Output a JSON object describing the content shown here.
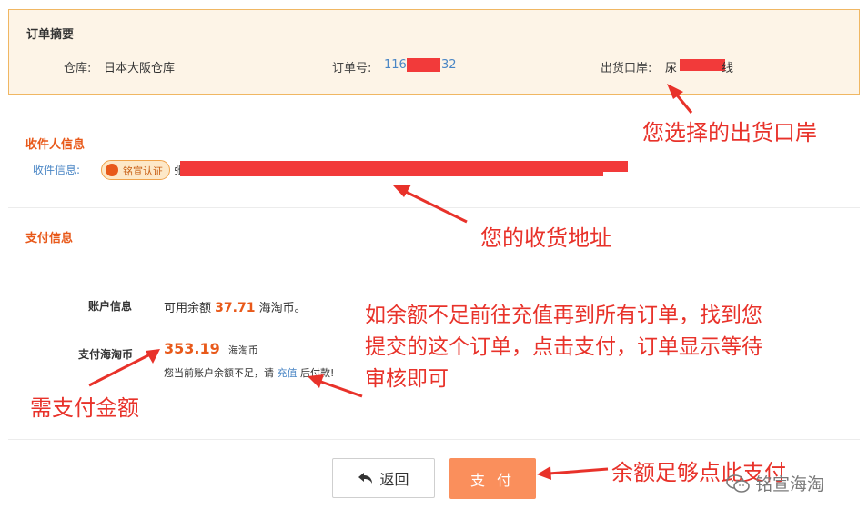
{
  "order_summary": {
    "title": "订单摘要",
    "warehouse_label": "仓库:",
    "warehouse_value": "日本大阪仓库",
    "order_no_label": "订单号:",
    "order_no_start": "116",
    "order_no_end": "32",
    "port_label": "出货口岸:",
    "port_value": "尿",
    "port_end": "线"
  },
  "recipient": {
    "section_title": "收件人信息",
    "info_label": "收件信息:",
    "badge": "铭宣认证",
    "name_prefix": "张"
  },
  "payment": {
    "section_title": "支付信息",
    "account_label": "账户信息",
    "balance_prefix": "可用余额",
    "balance_value": "37.71",
    "balance_unit": "海淘币。",
    "pay_label": "支付海淘币",
    "pay_amount": "353.19",
    "pay_unit": "海淘币",
    "note_prefix": "您当前账户余额不足，请",
    "note_link": "充值",
    "note_suffix": "后付款!"
  },
  "buttons": {
    "back": "返回",
    "pay": "支 付"
  },
  "annotations": {
    "port": "您选择的出货口岸",
    "address": "您的收货地址",
    "instruction_1": "如余额不足前往充值再到所有订单，找到您",
    "instruction_2": "提交的这个订单，点击支付，订单显示等待",
    "instruction_3": "审核即可",
    "amount": "需支付金额",
    "pay_hint": "余额足够点此支付"
  },
  "watermark": "铭宣海淘",
  "colors": {
    "accent_orange": "#e8591a",
    "pay_button": "#fa8f5c",
    "link_blue": "#4a86c5",
    "annotation_red": "#e8322a",
    "summary_bg": "#fdf4e7"
  }
}
